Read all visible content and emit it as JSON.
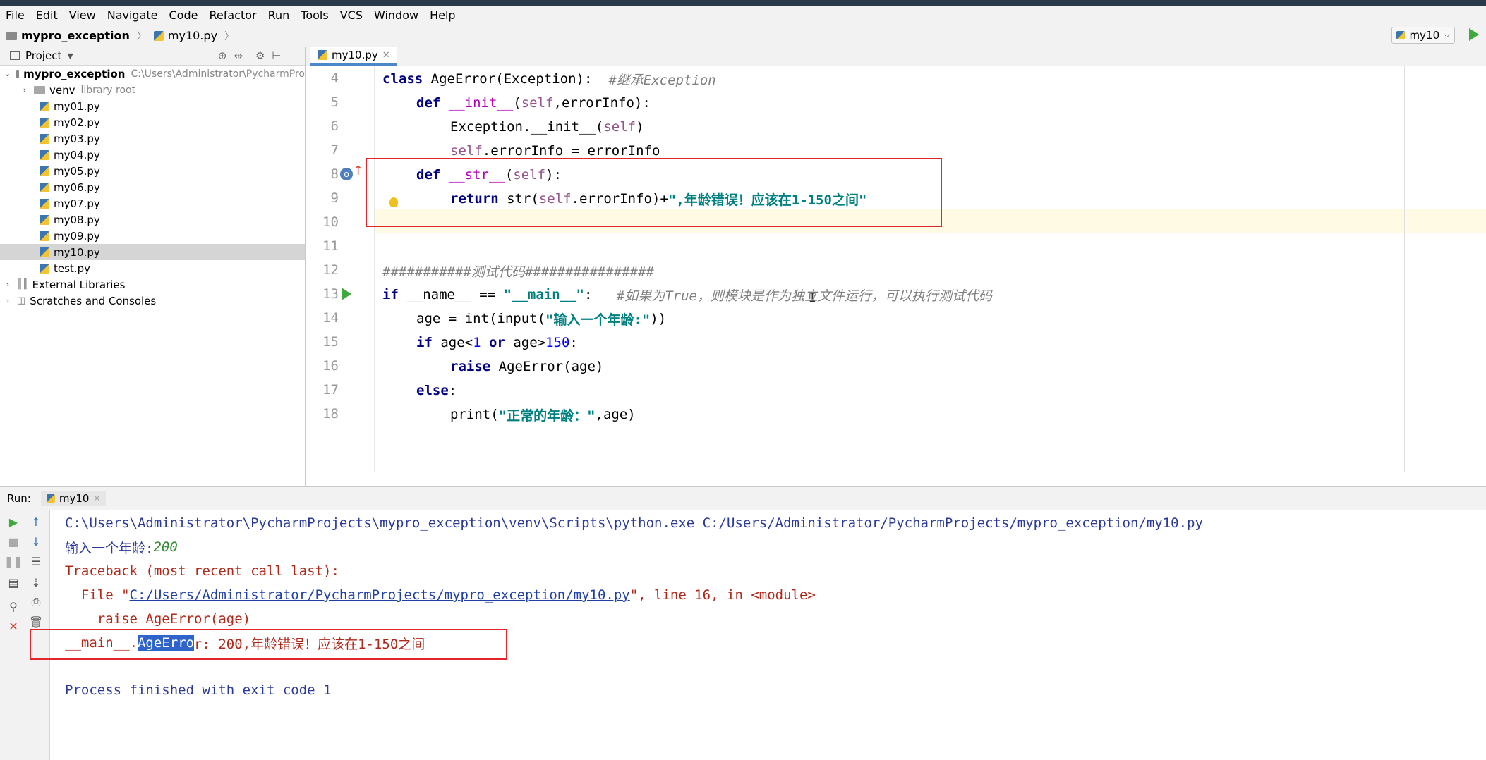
{
  "menu": [
    "File",
    "Edit",
    "View",
    "Navigate",
    "Code",
    "Refactor",
    "Run",
    "Tools",
    "VCS",
    "Window",
    "Help"
  ],
  "nav": {
    "project": "mypro_exception",
    "file": "my10.py",
    "run_config": "my10"
  },
  "project_panel": {
    "header": "Project",
    "root": {
      "name": "mypro_exception",
      "path": "C:\\Users\\Administrator\\PycharmPro"
    },
    "venv": {
      "name": "venv",
      "note": "library root"
    },
    "files": [
      "my01.py",
      "my02.py",
      "my03.py",
      "my04.py",
      "my05.py",
      "my06.py",
      "my07.py",
      "my08.py",
      "my09.py",
      "my10.py",
      "test.py"
    ],
    "selected_file": "my10.py",
    "external": "External Libraries",
    "scratches": "Scratches and Consoles"
  },
  "editor": {
    "tab": "my10.py",
    "line_numbers": [
      "4",
      "5",
      "6",
      "7",
      "8",
      "9",
      "10",
      "11",
      "12",
      "13",
      "14",
      "15",
      "16",
      "17",
      "18"
    ],
    "code": {
      "l4": {
        "kw": "class",
        "rest": " AgeError(Exception):  ",
        "comment": "#继承Exception"
      },
      "l5": {
        "kw": "def",
        "name": " __init__",
        "a": "(",
        "self": "self",
        "b": ",errorInfo):"
      },
      "l6": {
        "a": "Exception.__init__(",
        "self": "self",
        "b": ")"
      },
      "l7": {
        "self": "self",
        "b": ".errorInfo = errorInfo"
      },
      "l8": {
        "kw": "def",
        "name": " __str__",
        "a": "(",
        "self": "self",
        "b": "):"
      },
      "l9": {
        "kw": "return",
        "a": " str(",
        "self": "self",
        "b": ".errorInfo)+",
        "str": "\",年龄错误！应该在1-150之间\""
      },
      "l12": {
        "comment": "###########测试代码################"
      },
      "l13": {
        "kw": "if",
        "a": " __name__ == ",
        "str": "\"__main__\"",
        "b": ":   ",
        "comment": "#如果为True，则模块是作为独立文件运行，可以执行测试代码"
      },
      "l14": {
        "a": "age = int(input(",
        "str": "\"输入一个年龄:\"",
        "b": "))"
      },
      "l15": {
        "kw": "if",
        "a": " age<",
        "n1": "1",
        "kw2": " or",
        "b": " age>",
        "n2": "150",
        "c": ":"
      },
      "l16": {
        "kw": "raise",
        "a": " AgeError(age)"
      },
      "l17": {
        "kw": "else",
        "a": ":"
      },
      "l18": {
        "a": "print(",
        "str": "\"正常的年龄：\"",
        "b": ",age)"
      }
    }
  },
  "run": {
    "label": "Run:",
    "tab": "my10",
    "cmd": "C:\\Users\\Administrator\\PycharmProjects\\mypro_exception\\venv\\Scripts\\python.exe C:/Users/Administrator/PycharmProjects/mypro_exception/my10.py",
    "prompt": "输入一个年龄:",
    "input_value": "200",
    "traceback": "Traceback (most recent call last):",
    "file_prefix": "  File \"",
    "file_link": "C:/Users/Administrator/PycharmProjects/mypro_exception/my10.py",
    "file_suffix": "\", line 16, in <module>",
    "raise_line": "    raise AgeError(age)",
    "err_prefix": "__main__.",
    "err_selected": "AgeErro",
    "err_rest": "r: 200,年龄错误！应该在1-150之间",
    "finished": "Process finished with exit code 1"
  },
  "colors": {
    "highlight_box": "#e3262b",
    "selection": "#2f65ca",
    "run_green": "#3eaa3e"
  }
}
